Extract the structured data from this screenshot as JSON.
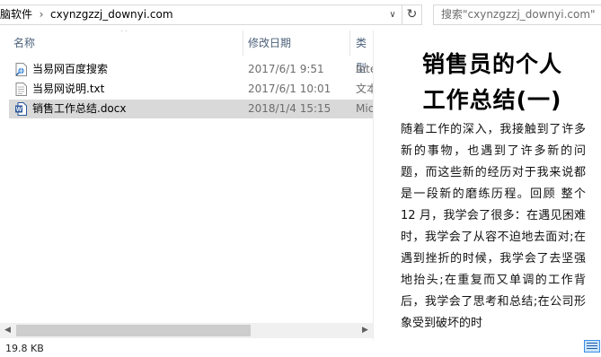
{
  "address": {
    "crumbs": [
      "脑软件",
      "cxynzgzzj_downyi.com"
    ],
    "separator": "›"
  },
  "search": {
    "placeholder": "搜索\"cxynzgzzj_downyi.com\""
  },
  "columns": {
    "name": "名称",
    "date": "修改日期",
    "type": "类型"
  },
  "files": [
    {
      "name": "当易网百度搜索",
      "date": "2017/6/1 9:51",
      "type": "Inte",
      "icon": "internet-shortcut-icon",
      "selected": false
    },
    {
      "name": "当易网说明.txt",
      "date": "2017/6/1 10:01",
      "type": "文本",
      "icon": "text-file-icon",
      "selected": false
    },
    {
      "name": "销售工作总结.docx",
      "date": "2018/1/4 15:15",
      "type": "Mic",
      "icon": "word-document-icon",
      "selected": true
    }
  ],
  "preview": {
    "title_line1": "销售员的个人",
    "title_line2": "工作总结(一)",
    "body": "随着工作的深入，我接触到了许多新的事物，也遇到了许多新的问题，而这些新的经历对于我来说都是一段新的磨练历程。回顾 整个 12 月，我学会了很多：在遇见困难时，我学会了从容不迫地去面对;在遇到挫折的时候，我学会了去坚强地抬头;在重复而又单调的工作背后，我学会了思考和总结;在公司形象受到破坏的时"
  },
  "status": {
    "size": "19.8 KB"
  },
  "colors": {
    "selected_row": "#d9d9d9",
    "header_text": "#4c607a",
    "accent": "#3a8ee6"
  }
}
